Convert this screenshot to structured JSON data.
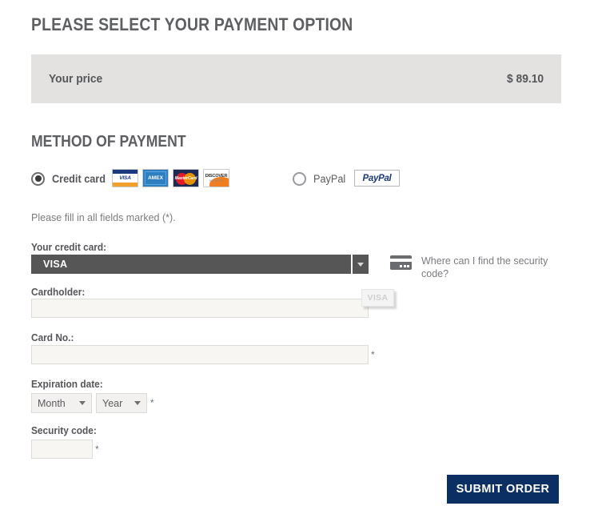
{
  "page": {
    "title": "PLEASE SELECT YOUR PAYMENT OPTION",
    "section_title": "METHOD OF PAYMENT"
  },
  "price": {
    "label": "Your price",
    "value": "$ 89.10"
  },
  "payment_methods": [
    {
      "id": "credit-card",
      "label": "Credit card",
      "selected": true
    },
    {
      "id": "paypal",
      "label": "PayPal",
      "selected": false
    }
  ],
  "card_brands": [
    {
      "name": "VISA",
      "icon": "visa-logo"
    },
    {
      "name": "AMEX",
      "icon": "amex-logo"
    },
    {
      "name": "MasterCard",
      "icon": "mastercard-logo"
    },
    {
      "name": "DISCOVER",
      "icon": "discover-logo"
    }
  ],
  "paypal_logo_text": "PayPal",
  "form": {
    "required_hint": "Please fill in all fields marked (*).",
    "credit_card_label": "Your credit card:",
    "credit_card_value": "VISA",
    "ghost_option_value": "VISA",
    "cardholder_label": "Cardholder:",
    "cardholder_value": "",
    "cardholder_placeholder": "",
    "card_number_label": "Card No.:",
    "card_number_value": "",
    "card_number_placeholder": "",
    "expiration_label": "Expiration date:",
    "month_value": "Month",
    "year_value": "Year",
    "security_code_label": "Security code:",
    "security_code_value": "",
    "security_code_placeholder": "",
    "asterisk": "*"
  },
  "cvv_help": {
    "text": "Where can I find the security code?",
    "icon": "credit-card-cvv-icon"
  },
  "submit": {
    "label": "SUBMIT ORDER"
  },
  "colors": {
    "heading": "#5d5f63",
    "price_bar_bg": "#e3e2e0",
    "select_dark": "#565656",
    "submit_bg": "#0b2f63",
    "input_bg": "#f7f6f3"
  }
}
